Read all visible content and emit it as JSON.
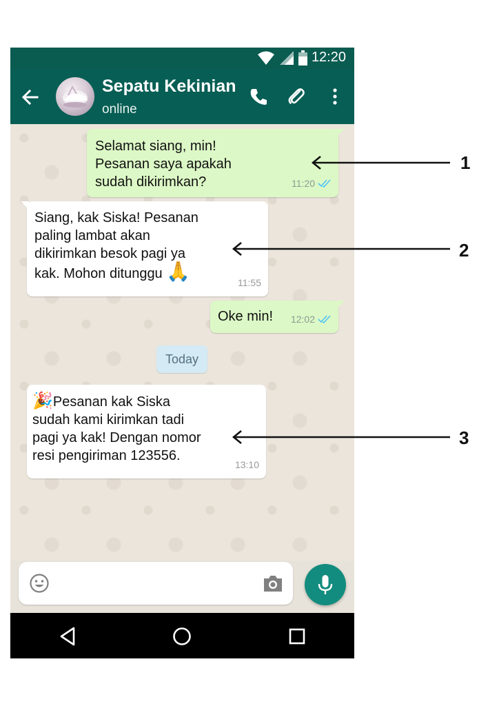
{
  "status_bar": {
    "time": "12:20"
  },
  "header": {
    "contact_name": "Sepatu Kekinian",
    "contact_status": "online",
    "icons": [
      "back-arrow-icon",
      "phone-icon",
      "paperclip-icon",
      "more-vert-icon"
    ]
  },
  "messages": [
    {
      "direction": "outgoing",
      "text": "Selamat siang, min!\nPesanan saya apakah\nsudah dikirimkan?",
      "time": "11:20",
      "read_receipt": "double-check-blue"
    },
    {
      "direction": "incoming",
      "text": "Siang, kak Siska! Pesanan\npaling lambat akan\ndikirimkan besok pagi ya\nkak. Mohon ditunggu",
      "emoji": "🙏",
      "time": "11:55"
    },
    {
      "direction": "outgoing",
      "text": "Oke min!",
      "time": "12:02",
      "read_receipt": "double-check-blue"
    },
    {
      "direction": "incoming",
      "emoji": "🎉",
      "text": "Pesanan kak Siska\nsudah kami kirimkan tadi\npagi ya kak! Dengan nomor\nresi pengiriman 123556.",
      "time": "13:10"
    }
  ],
  "date_divider": "Today",
  "input_bar": {
    "placeholder": ""
  },
  "callouts": [
    "1",
    "2",
    "3"
  ],
  "colors": {
    "header": "#075e54",
    "status_bar": "#0a5b50",
    "outgoing_bubble": "#dcf8c6",
    "incoming_bubble": "#ffffff",
    "mic_button": "#128c7e",
    "read_tick": "#4fc3f7"
  }
}
